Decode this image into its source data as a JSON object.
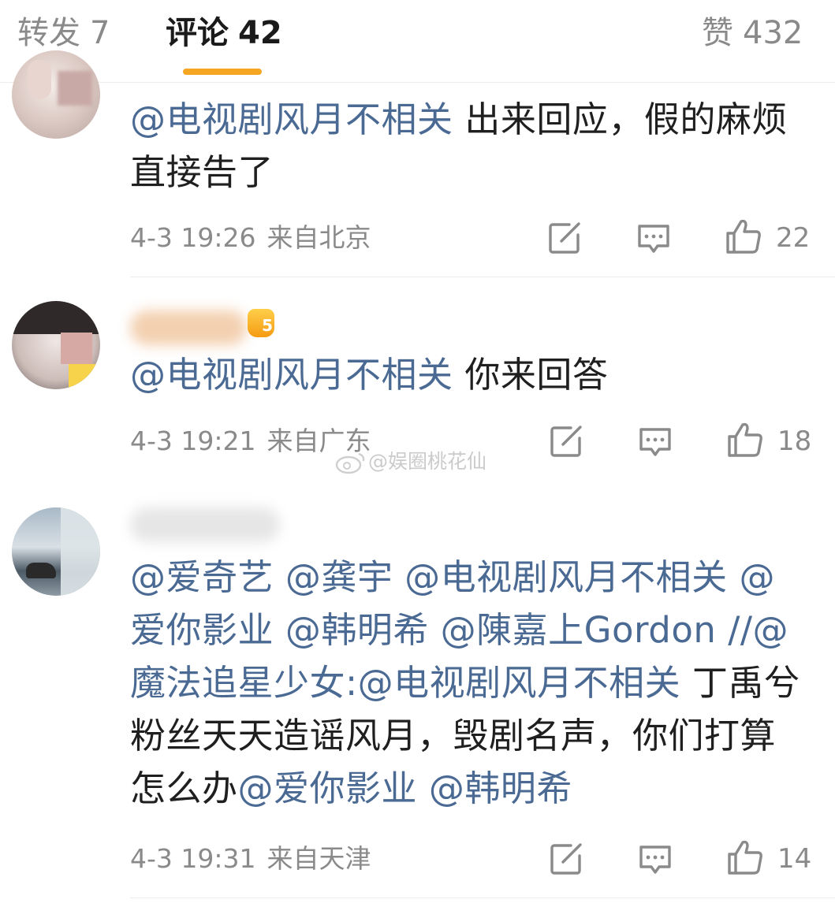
{
  "tabs": {
    "reposts": {
      "label": "转发",
      "count": "7"
    },
    "comments": {
      "label": "评论",
      "count": "42"
    },
    "likes": {
      "label": "赞",
      "count": "432"
    }
  },
  "comments": [
    {
      "segments": [
        {
          "type": "mention",
          "text": "@电视剧风月不相关"
        },
        {
          "type": "text",
          "text": " 出来回应，假的麻烦直接告了"
        }
      ],
      "time": "4-3 19:26",
      "location": "来自北京",
      "likes": "22"
    },
    {
      "segments": [
        {
          "type": "mention",
          "text": "@电视剧风月不相关"
        },
        {
          "type": "text",
          "text": " 你来回答"
        }
      ],
      "time": "4-3 19:21",
      "location": "来自广东",
      "likes": "18",
      "level_badge": "5"
    },
    {
      "segments": [
        {
          "type": "mention",
          "text": "@爱奇艺"
        },
        {
          "type": "text",
          "text": " "
        },
        {
          "type": "mention",
          "text": "@龚宇"
        },
        {
          "type": "text",
          "text": " "
        },
        {
          "type": "mention",
          "text": "@电视剧风月不相关"
        },
        {
          "type": "text",
          "text": " "
        },
        {
          "type": "mention",
          "text": "@爱你影业"
        },
        {
          "type": "text",
          "text": " "
        },
        {
          "type": "mention",
          "text": "@韩明希"
        },
        {
          "type": "text",
          "text": " "
        },
        {
          "type": "mention",
          "text": "@陳嘉上Gordon"
        },
        {
          "type": "text",
          "text": " "
        },
        {
          "type": "mention",
          "text": "//@魔法追星少女:"
        },
        {
          "type": "mention",
          "text": "@电视剧风月不相关"
        },
        {
          "type": "text",
          "text": " 丁禹兮粉丝天天造谣风月，毁剧名声，你们打算怎么办"
        },
        {
          "type": "mention",
          "text": "@爱你影业"
        },
        {
          "type": "text",
          "text": " "
        },
        {
          "type": "mention",
          "text": "@韩明希"
        }
      ],
      "time": "4-3 19:31",
      "location": "来自天津",
      "likes": "14"
    }
  ],
  "watermark": "@娱圈桃花仙",
  "colors": {
    "mention": "#4a6a94",
    "accent": "#f5a623",
    "muted": "#8a8a8a"
  }
}
